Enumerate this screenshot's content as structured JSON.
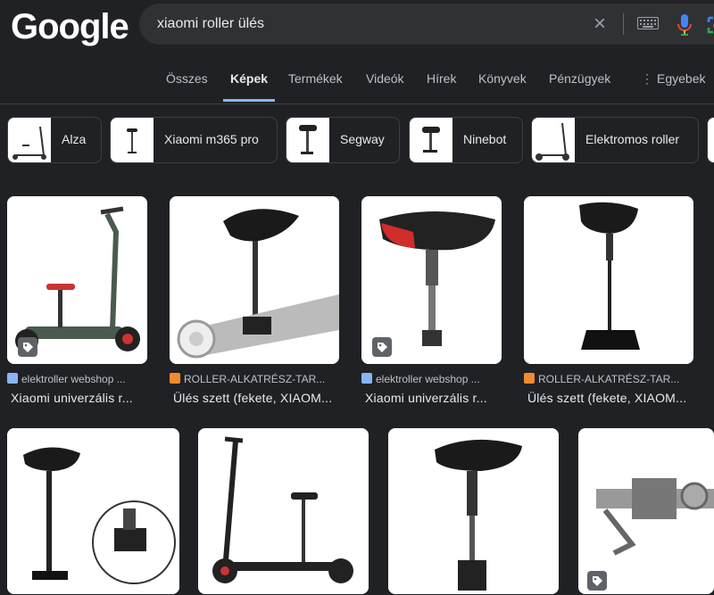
{
  "logo": "Google",
  "search": {
    "value": "xiaomi roller ülés"
  },
  "tabs": [
    "Összes",
    "Képek",
    "Termékek",
    "Videók",
    "Hírek",
    "Könyvek",
    "Pénzügyek",
    "Egyebek"
  ],
  "active_tab": "Képek",
  "chips": [
    "Alza",
    "Xiaomi m365 pro",
    "Segway",
    "Ninebot",
    "Elektromos roller"
  ],
  "results": [
    {
      "source": "elektroller webshop ...",
      "title": "Xiaomi univerzális r..."
    },
    {
      "source": "ROLLER-ALKATRÉSZ-TAR...",
      "title": "Ülés szett (fekete, XIAOM..."
    },
    {
      "source": "elektroller webshop ...",
      "title": "Xiaomi univerzális r..."
    },
    {
      "source": "ROLLER-ALKATRÉSZ-TAR...",
      "title": "Ülés szett (fekete, XIAOM..."
    }
  ],
  "colors": {
    "background": "#202124",
    "accent": "#8ab4f8",
    "text": "#e8eaed",
    "muted": "#bdc1c6"
  }
}
